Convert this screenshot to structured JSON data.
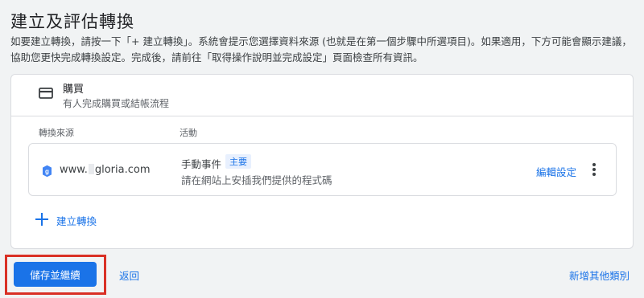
{
  "page": {
    "title": "建立及評估轉換",
    "description": "如要建立轉換，請按一下「+ 建立轉換」。系統會提示您選擇資料來源 (也就是在第一個步驟中所選項目)。如果適用，下方可能會顯示建議，協助您更快完成轉換設定。完成後，請前往「取得操作說明並完成設定」頁面檢查所有資訊。"
  },
  "goal": {
    "title": "購買",
    "subtitle": "有人完成購買或結帳流程",
    "icon": "credit-card-icon"
  },
  "table": {
    "col_source": "轉換來源",
    "col_action": "活動",
    "rows": [
      {
        "source_icon": "google-tag-icon",
        "domain_prefix": "www.",
        "domain_suffix": "gloria.com",
        "action_title": "手動事件",
        "badge": "主要",
        "action_subtitle": "請在網站上安插我們提供的程式碼",
        "edit_label": "編輯設定"
      }
    ]
  },
  "create_label": "建立轉換",
  "footer": {
    "save_label": "儲存並繼續",
    "back_label": "返回",
    "add_category_label": "新增其他類別"
  },
  "colors": {
    "accent": "#1a73e8",
    "highlight_border": "#d93025",
    "background": "#f1f3f4"
  }
}
